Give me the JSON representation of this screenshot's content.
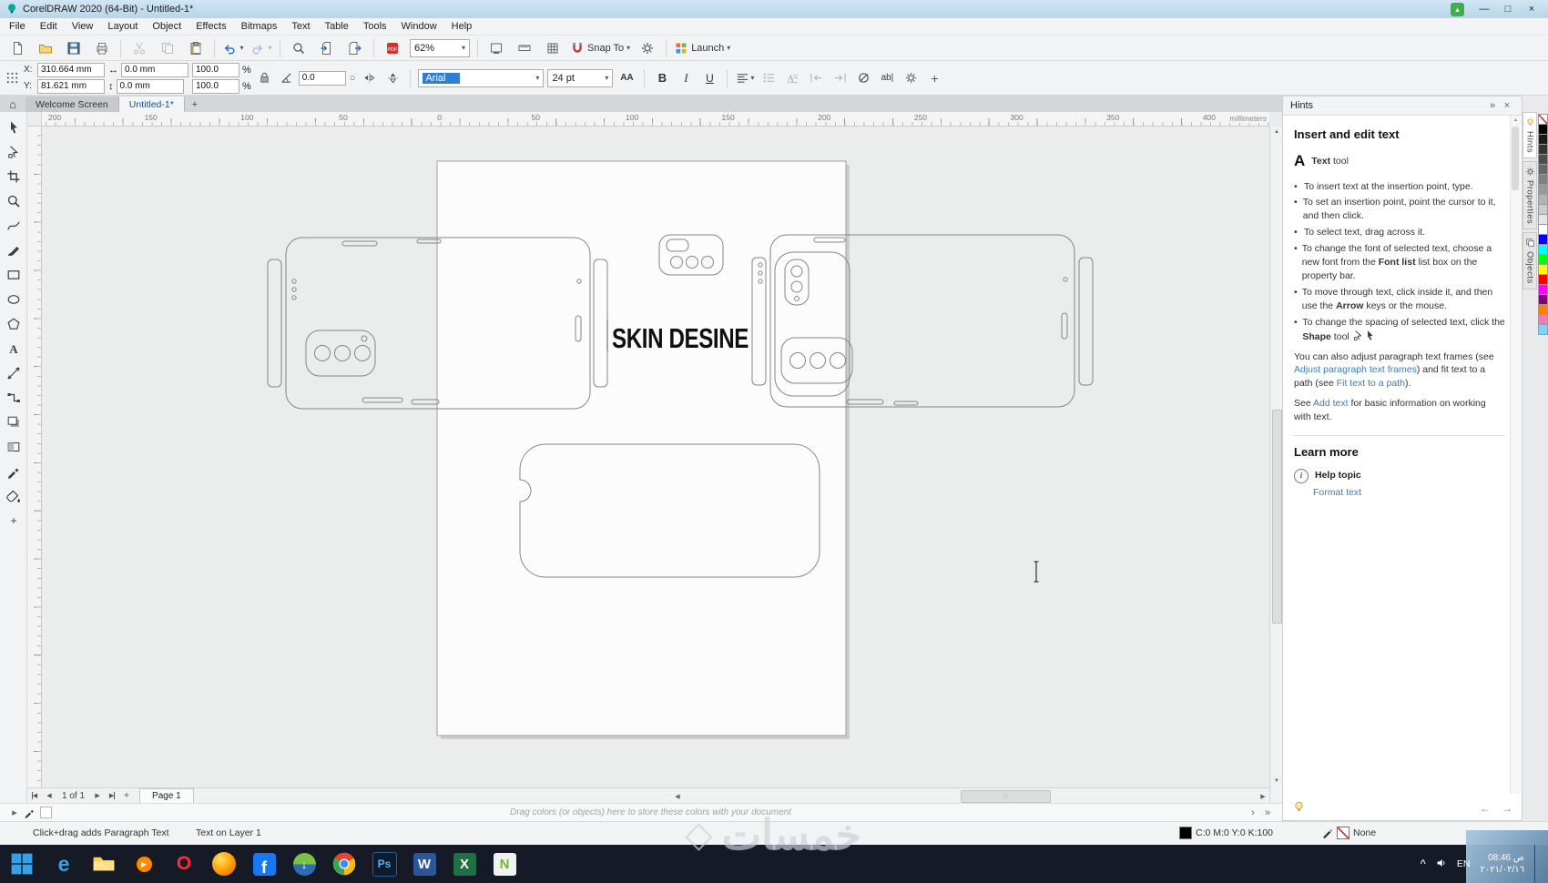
{
  "window": {
    "title": "CorelDRAW 2020 (64-Bit) - Untitled-1*"
  },
  "menubar": [
    "File",
    "Edit",
    "View",
    "Layout",
    "Object",
    "Effects",
    "Bitmaps",
    "Text",
    "Table",
    "Tools",
    "Window",
    "Help"
  ],
  "standard_toolbar": {
    "zoom_value": "62%",
    "items": [
      {
        "name": "new-document",
        "icon": "doc"
      },
      {
        "name": "open",
        "icon": "folder"
      },
      {
        "name": "save",
        "icon": "disk"
      },
      {
        "name": "print",
        "icon": "printer"
      },
      {
        "sep": true
      },
      {
        "name": "cut",
        "icon": "cut",
        "disabled": true
      },
      {
        "name": "copy",
        "icon": "copy",
        "disabled": true
      },
      {
        "name": "paste",
        "icon": "paste"
      },
      {
        "sep": true
      },
      {
        "name": "undo",
        "icon": "undo",
        "arrow": true
      },
      {
        "name": "redo",
        "icon": "redo",
        "arrow": true,
        "disabled": true
      },
      {
        "sep": true
      },
      {
        "name": "search-content",
        "icon": "search"
      },
      {
        "name": "import",
        "icon": "import"
      },
      {
        "name": "export",
        "icon": "export"
      },
      {
        "sep": true
      },
      {
        "name": "publish-to-pdf",
        "icon": "pdf"
      },
      {
        "zoom_combo": true,
        "name": "zoom-levels"
      },
      {
        "sep": true
      },
      {
        "name": "full-screen-preview",
        "icon": "fullscreen"
      },
      {
        "name": "show-rulers",
        "icon": "rulers"
      },
      {
        "name": "show-grid",
        "icon": "grid"
      },
      {
        "name": "snap-to",
        "icon": "snap",
        "label": "Snap To",
        "arrow": true
      },
      {
        "name": "options",
        "icon": "gear"
      },
      {
        "sep": true
      },
      {
        "name": "launch",
        "icon": "launch",
        "label": "Launch",
        "arrow": true
      }
    ]
  },
  "property_bar": {
    "x_label": "X:",
    "x_value": "310.664 mm",
    "y_label": "Y:",
    "y_value": "81.621 mm",
    "width_value": "0.0 mm",
    "height_value": "0.0 mm",
    "scale_h": "100.0",
    "scale_v": "100.0",
    "percent": "%",
    "rotation_value": "0.0",
    "font_name": "Arial",
    "font_size": "24 pt",
    "bold": "B",
    "italic": "I",
    "underline": "U",
    "aa": "AA",
    "edit_text": "ab|"
  },
  "document_tabs": {
    "tabs": [
      {
        "label": "Welcome Screen",
        "active": false
      },
      {
        "label": "Untitled-1*",
        "active": true
      }
    ],
    "add_label": "+"
  },
  "ruler": {
    "labels": [
      "200",
      "150",
      "100",
      "50",
      "0",
      "50",
      "100",
      "150",
      "200",
      "250",
      "300",
      "350",
      "400"
    ],
    "units": "millimeters"
  },
  "toolbox": [
    "pick-tool",
    "shape-tool",
    "crop-tool",
    "zoom-tool",
    "freehand-tool",
    "artistic-media-tool",
    "rectangle-tool",
    "ellipse-tool",
    "polygon-tool",
    "text-tool",
    "dimension-tool",
    "connector-tool",
    "drop-shadow-tool",
    "transparency-tool",
    "color-eyedropper-tool",
    "interactive-fill-tool",
    "more-tools"
  ],
  "canvas": {
    "design_text": "SKIN DESINE"
  },
  "hints": {
    "title": "Hints",
    "section_title": "Insert and edit text",
    "tool_glyph": "A",
    "tool_parts": [
      {
        "b": "Text"
      },
      {
        "t": " tool"
      }
    ],
    "bullets": [
      [
        {
          "t": "To insert text at the insertion point, type."
        }
      ],
      [
        {
          "t": "To set an insertion point, point the cursor to it, and then click."
        }
      ],
      [
        {
          "t": "To select text, drag across it."
        }
      ],
      [
        {
          "t": "To change the font of selected text, choose a new font from the "
        },
        {
          "b": "Font list"
        },
        {
          "t": " list box on the property bar."
        }
      ],
      [
        {
          "t": "To move through text, click inside it, and then use the "
        },
        {
          "b": "Arrow"
        },
        {
          "t": " keys or the mouse."
        }
      ],
      [
        {
          "t": "To change the spacing of selected text, click the "
        },
        {
          "b": "Shape"
        },
        {
          "t": " tool "
        },
        {
          "i": "shape-tool"
        },
        {
          "i": "cursor"
        }
      ]
    ],
    "paragraphs": [
      [
        {
          "t": "You can also adjust paragraph text frames (see "
        },
        {
          "l": "Adjust paragraph text frames"
        },
        {
          "t": ") and fit text to a path (see "
        },
        {
          "l": "Fit text to a path"
        },
        {
          "t": ")."
        }
      ],
      [
        {
          "t": "See "
        },
        {
          "l": "Add text"
        },
        {
          "t": " for basic information on working with text."
        }
      ]
    ],
    "learn_more": "Learn more",
    "help_topic": "Help topic",
    "format_text": "Format text"
  },
  "docker_tabs": [
    {
      "label": "Hints",
      "active": true
    },
    {
      "label": "Properties",
      "active": false
    },
    {
      "label": "Objects",
      "active": false
    }
  ],
  "palette": [
    "none",
    "#000000",
    "#1a1a1a",
    "#333333",
    "#4d4d4d",
    "#666666",
    "#808080",
    "#999999",
    "#b3b3b3",
    "#cccccc",
    "#e6e6e6",
    "#ffffff",
    "#0000ff",
    "#00ffff",
    "#00ff00",
    "#ffff00",
    "#ff0000",
    "#ff00ff",
    "#7f007f",
    "#ff7f00",
    "#e87fb0",
    "#7fd4ff"
  ],
  "page_nav": {
    "counter": "1 of 1",
    "page_tab": "Page 1"
  },
  "doc_palette_hint": "Drag colors (or objects) here to store these colors with your document",
  "status_bar": {
    "hint": "Click+drag adds Paragraph Text",
    "layer": "Text on Layer 1",
    "fill_value": "C:0 M:0 Y:0 K:100",
    "outline_value": "None"
  },
  "taskbar": {
    "apps": [
      "start",
      "edge",
      "file-explorer",
      "media-player",
      "opera",
      "firefox",
      "facebook",
      "download-manager",
      "chrome",
      "photoshop",
      "word",
      "excel",
      "notepad-plus"
    ],
    "language": "EN",
    "time": "08:46 ص",
    "date": "٢٠٢١/٠٢/١٦"
  },
  "watermark": "خمسات"
}
